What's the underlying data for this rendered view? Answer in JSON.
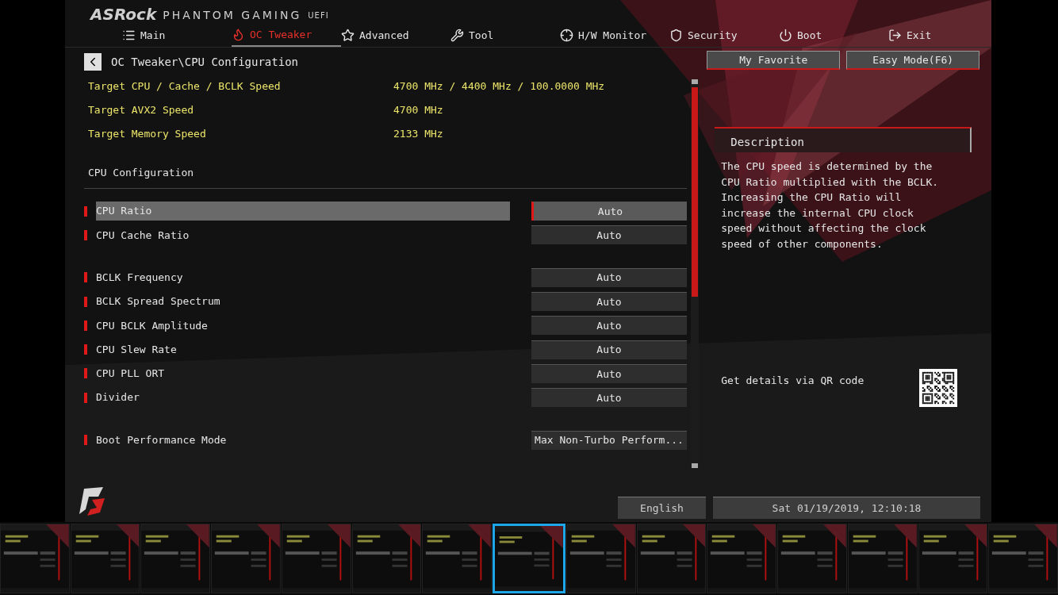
{
  "brand": {
    "name": "ASRock",
    "product": "PHANTOM GAMING",
    "suffix": "UEFI"
  },
  "tabs": [
    {
      "label": "Main",
      "kind": "list",
      "selected": false
    },
    {
      "label": "OC Tweaker",
      "kind": "flame",
      "selected": true
    },
    {
      "label": "Advanced",
      "kind": "star",
      "selected": false
    },
    {
      "label": "Tool",
      "kind": "tool",
      "selected": false
    },
    {
      "label": "H/W Monitor",
      "kind": "monitor",
      "selected": false
    },
    {
      "label": "Security",
      "kind": "shield",
      "selected": false
    },
    {
      "label": "Boot",
      "kind": "power",
      "selected": false
    },
    {
      "label": "Exit",
      "kind": "exit",
      "selected": false
    }
  ],
  "breadcrumb": "OC Tweaker\\CPU Configuration",
  "info": [
    {
      "label": "Target CPU / Cache / BCLK Speed",
      "value": "4700 MHz / 4400 MHz / 100.0000 MHz"
    },
    {
      "label": "Target AVX2 Speed",
      "value": "4700 MHz"
    },
    {
      "label": "Target Memory Speed",
      "value": "2133 MHz"
    }
  ],
  "section_title": "CPU Configuration",
  "groups": [
    [
      {
        "label": "CPU Ratio",
        "value": "Auto",
        "selected": true
      },
      {
        "label": "CPU Cache Ratio",
        "value": "Auto",
        "selected": false
      }
    ],
    [
      {
        "label": "BCLK Frequency",
        "value": "Auto",
        "selected": false
      },
      {
        "label": "BCLK Spread Spectrum",
        "value": "Auto",
        "selected": false
      },
      {
        "label": "CPU BCLK Amplitude",
        "value": "Auto",
        "selected": false
      },
      {
        "label": "CPU Slew Rate",
        "value": "Auto",
        "selected": false
      },
      {
        "label": "CPU PLL ORT",
        "value": "Auto",
        "selected": false
      },
      {
        "label": "Divider",
        "value": "Auto",
        "selected": false
      }
    ],
    [
      {
        "label": "Boot Performance Mode",
        "value": "Max Non-Turbo Perform...",
        "selected": false
      }
    ]
  ],
  "side_buttons": [
    "My Favorite",
    "Easy Mode(F6)"
  ],
  "description": {
    "title": "Description",
    "text": "The CPU speed is determined by the CPU Ratio multiplied with the BCLK. Increasing the CPU Ratio will increase the internal CPU clock speed without affecting the clock speed of other components.",
    "qr_label": "Get details via QR code"
  },
  "footer": {
    "language": "English",
    "datetime": "Sat 01/19/2019, 12:10:18"
  },
  "thumbnails": [
    {
      "selected": false
    },
    {
      "selected": false
    },
    {
      "selected": false
    },
    {
      "selected": false
    },
    {
      "selected": false
    },
    {
      "selected": false
    },
    {
      "selected": false
    },
    {
      "selected": true
    },
    {
      "selected": false
    },
    {
      "selected": false
    },
    {
      "selected": false
    },
    {
      "selected": false
    },
    {
      "selected": false
    },
    {
      "selected": false
    },
    {
      "selected": false
    }
  ]
}
